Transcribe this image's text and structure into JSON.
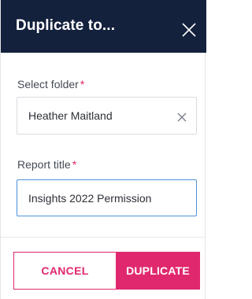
{
  "dialog": {
    "title": "Duplicate to...",
    "close_icon": "close-icon"
  },
  "folder_field": {
    "label": "Select folder",
    "required_mark": "*",
    "value": "Heather Maitland",
    "clear_icon": "close-icon"
  },
  "title_field": {
    "label": "Report title",
    "required_mark": "*",
    "value": "Insights 2022 Permission"
  },
  "actions": {
    "cancel_label": "CANCEL",
    "duplicate_label": "DUPLICATE"
  },
  "colors": {
    "header_bg": "#14213d",
    "accent": "#e0286e",
    "input_focus_border": "#4a90d9"
  }
}
